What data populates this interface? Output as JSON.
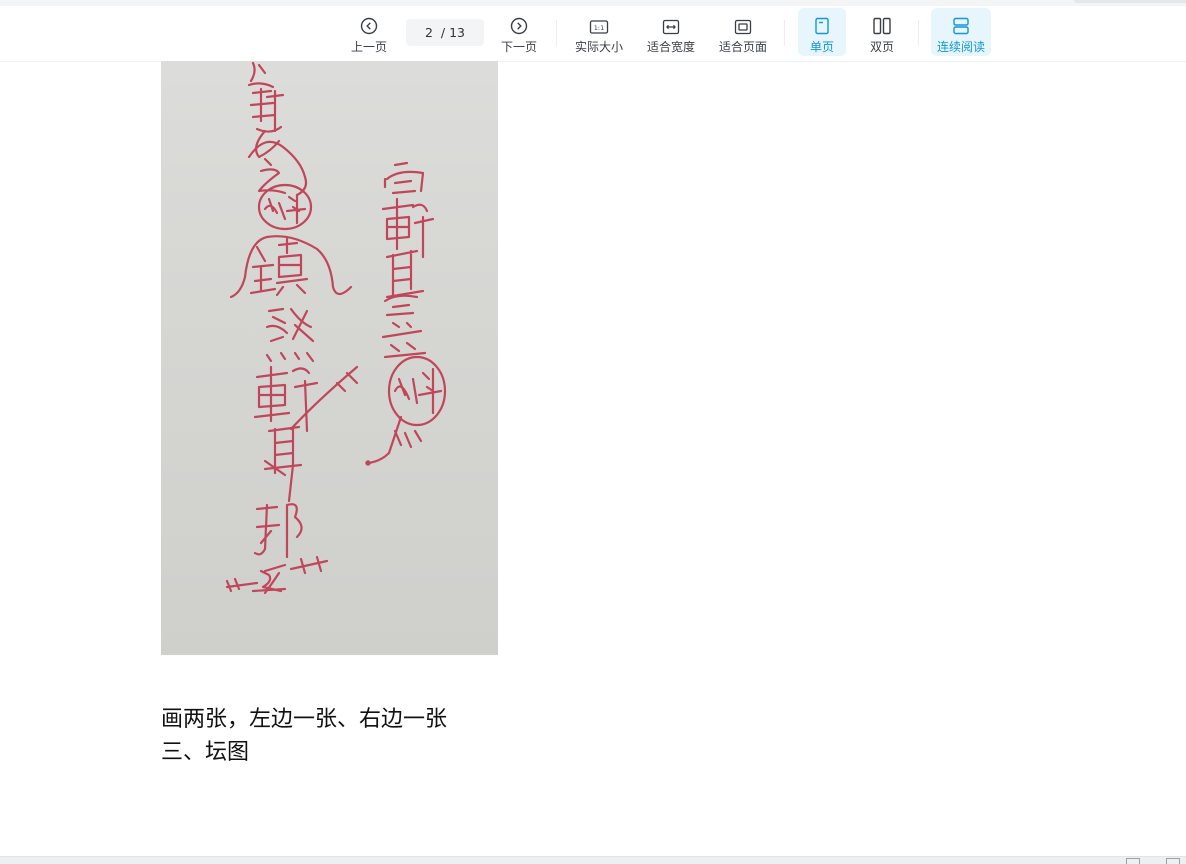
{
  "toolbar": {
    "prev_label": "上一页",
    "page_current": "2",
    "page_total": "/ 13",
    "next_label": "下一页",
    "actual_size_label": "实际大小",
    "fit_width_label": "适合宽度",
    "fit_page_label": "适合页面",
    "single_page_label": "单页",
    "double_page_label": "双页",
    "continuous_label": "连续阅读",
    "active_color": "#1296db"
  },
  "document": {
    "line1": "画两张，左边一张、右边一张",
    "line2": "三、坛图"
  }
}
